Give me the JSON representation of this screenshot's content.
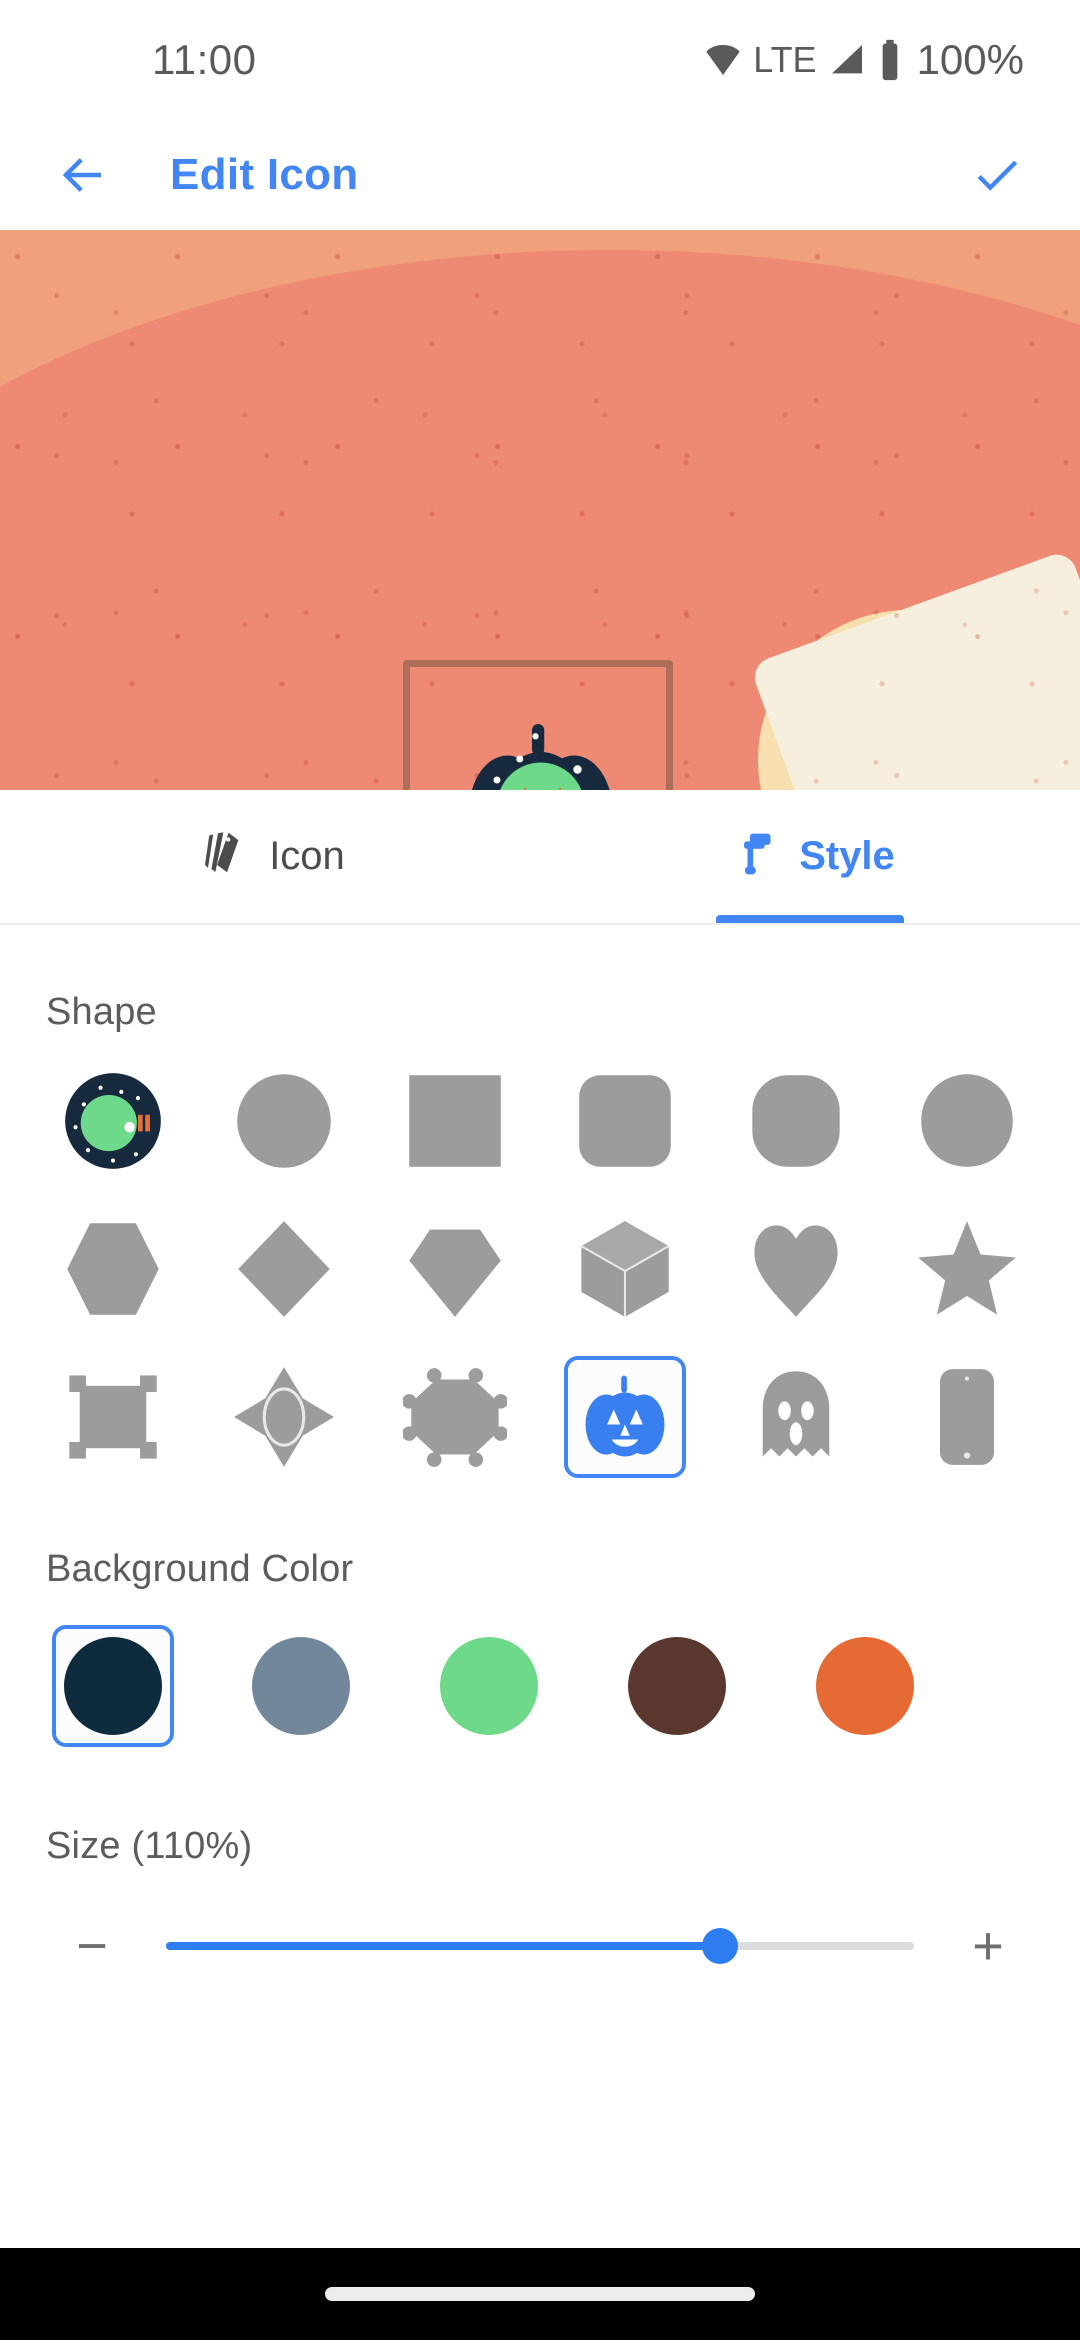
{
  "status_bar": {
    "time": "11:00",
    "network_label": "LTE",
    "battery_label": "100%",
    "wifi_icon": "wifi-icon",
    "signal_icon": "cellular-signal-icon",
    "battery_icon": "battery-full-icon"
  },
  "app_bar": {
    "back_icon": "back-arrow-icon",
    "title": "Edit Icon",
    "confirm_icon": "checkmark-icon",
    "accent_color": "#4286f4"
  },
  "preview": {
    "background_color": "#f0a07a",
    "background_lower_color": "#ee8a74",
    "sun_color": "#f7dfaf",
    "frame_color": "#785541",
    "icon_name": "pumpkin-preview-icon",
    "icon_body_color": "#16293d",
    "icon_face_color": "#6ed98a",
    "icon_feature_color": "#e8703a"
  },
  "tabs": [
    {
      "label": "Icon",
      "icon": "layers-icon",
      "active": false
    },
    {
      "label": "Style",
      "icon": "paint-roller-icon",
      "active": true
    }
  ],
  "shape": {
    "title": "Shape",
    "rows": [
      [
        {
          "name": "current-pumpkin-circle-shape",
          "selected": false
        },
        {
          "name": "circle-shape",
          "selected": false
        },
        {
          "name": "square-shape",
          "selected": false
        },
        {
          "name": "rounded-square-shape",
          "selected": false
        },
        {
          "name": "squircle-shape",
          "selected": false
        },
        {
          "name": "teardrop-shape",
          "selected": false
        }
      ],
      [
        {
          "name": "hexagon-shape",
          "selected": false
        },
        {
          "name": "diamond-shape",
          "selected": false
        },
        {
          "name": "gem-shape",
          "selected": false
        },
        {
          "name": "cube-shape",
          "selected": false
        },
        {
          "name": "heart-shape",
          "selected": false
        },
        {
          "name": "star-shape",
          "selected": false
        }
      ],
      [
        {
          "name": "crop-frame-shape",
          "selected": false
        },
        {
          "name": "compass-burst-shape",
          "selected": false
        },
        {
          "name": "dotted-octagon-shape",
          "selected": false
        },
        {
          "name": "pumpkin-shape",
          "selected": true
        },
        {
          "name": "ghost-shape",
          "selected": false
        },
        {
          "name": "phone-shape",
          "selected": false
        }
      ]
    ]
  },
  "background_color": {
    "title": "Background Color",
    "swatches": [
      {
        "name": "swatch-dark-navy",
        "color": "#0f2c3f",
        "selected": true
      },
      {
        "name": "swatch-slate-blue",
        "color": "#72889a",
        "selected": false
      },
      {
        "name": "swatch-green",
        "color": "#6ed98a",
        "selected": false
      },
      {
        "name": "swatch-brown",
        "color": "#5a3830",
        "selected": false
      },
      {
        "name": "swatch-orange",
        "color": "#e56a33",
        "selected": false
      }
    ]
  },
  "size": {
    "title": "Size  (110%)",
    "value_percent": 110,
    "fill_percent": 74,
    "decrease_label": "−",
    "increase_label": "+",
    "accent_color": "#2e7df0"
  },
  "nav_bar": {
    "gesture_pill": "gesture-pill"
  }
}
